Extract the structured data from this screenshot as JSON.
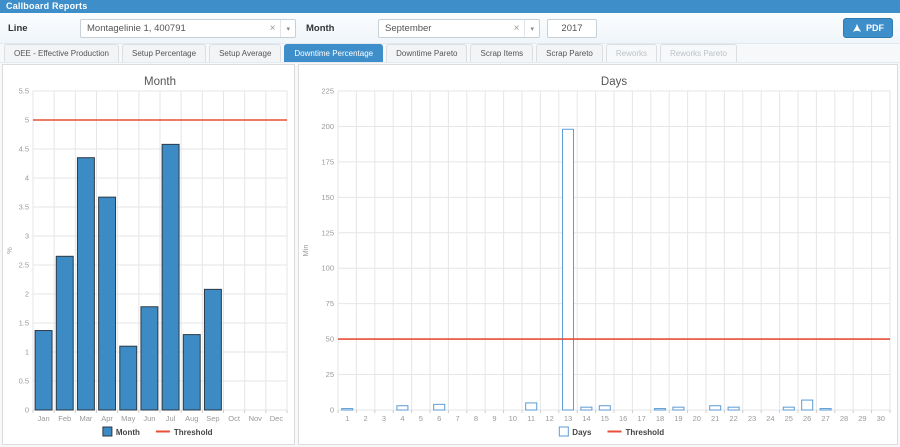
{
  "header": {
    "title": "Callboard Reports"
  },
  "filters": {
    "line_label": "Line",
    "line_value": "Montagelinie 1, 400791",
    "month_label": "Month",
    "month_value": "September",
    "year_value": "2017",
    "pdf_label": "PDF",
    "clear_icon": "×",
    "caret_icon": "▾"
  },
  "tabs": [
    {
      "label": "OEE - Effective Production",
      "state": "normal"
    },
    {
      "label": "Setup Percentage",
      "state": "normal"
    },
    {
      "label": "Setup Average",
      "state": "normal"
    },
    {
      "label": "Downtime Percentage",
      "state": "active"
    },
    {
      "label": "Downtime Pareto",
      "state": "normal"
    },
    {
      "label": "Scrap Items",
      "state": "normal"
    },
    {
      "label": "Scrap Pareto",
      "state": "normal"
    },
    {
      "label": "Reworks",
      "state": "disabled"
    },
    {
      "label": "Reworks Pareto",
      "state": "disabled"
    }
  ],
  "colors": {
    "accent": "#3d8ec9",
    "threshold_red": "#e94f37",
    "bar_blue_fill": "#3d8bc4",
    "bar_blue_stroke": "#2d3a45",
    "bar_outline_blue": "#5b9bd5",
    "grid": "#e4e6e8",
    "tick_text": "#999999",
    "title_text": "#555555",
    "legend_text": "#444444"
  },
  "chart_data": [
    {
      "type": "bar",
      "title": "Month",
      "bar_style": "filled",
      "categories": [
        "Jan",
        "Feb",
        "Mar",
        "Apr",
        "May",
        "Jun",
        "Jul",
        "Aug",
        "Sep",
        "Oct",
        "Nov",
        "Dec"
      ],
      "values": [
        1.37,
        2.65,
        4.35,
        3.67,
        1.1,
        1.78,
        4.58,
        1.3,
        2.08,
        null,
        null,
        null
      ],
      "threshold": 5,
      "xlabel": "",
      "ylabel": "%",
      "ylim": [
        0,
        5.5
      ],
      "ytick": 0.5,
      "grid": true,
      "legend_position": "bottom",
      "legend": [
        {
          "label": "Month",
          "type": "bar"
        },
        {
          "label": "Threshold",
          "type": "line"
        }
      ],
      "bar_fill": "#3d8bc4",
      "bar_stroke": "#2d3a45",
      "threshold_color": "#e94f37"
    },
    {
      "type": "bar",
      "title": "Days",
      "bar_style": "outline",
      "categories": [
        "1",
        "2",
        "3",
        "4",
        "5",
        "6",
        "7",
        "8",
        "9",
        "10",
        "11",
        "12",
        "13",
        "14",
        "15",
        "16",
        "17",
        "18",
        "19",
        "20",
        "21",
        "22",
        "23",
        "24",
        "25",
        "26",
        "27",
        "28",
        "29",
        "30"
      ],
      "values": [
        1,
        0,
        0,
        3,
        0,
        4,
        0,
        0,
        0,
        0,
        5,
        0,
        198,
        2,
        3,
        0,
        0,
        1,
        2,
        0,
        3,
        2,
        0,
        0,
        2,
        7,
        1,
        0,
        0,
        0
      ],
      "threshold": 50,
      "xlabel": "",
      "ylabel": "Min",
      "ylim": [
        0,
        225
      ],
      "ytick": 25,
      "grid": true,
      "legend_position": "bottom",
      "legend": [
        {
          "label": "Days",
          "type": "bar"
        },
        {
          "label": "Threshold",
          "type": "line"
        }
      ],
      "bar_fill": "#ffffff",
      "bar_stroke": "#5b9bd5",
      "threshold_color": "#e94f37"
    }
  ]
}
